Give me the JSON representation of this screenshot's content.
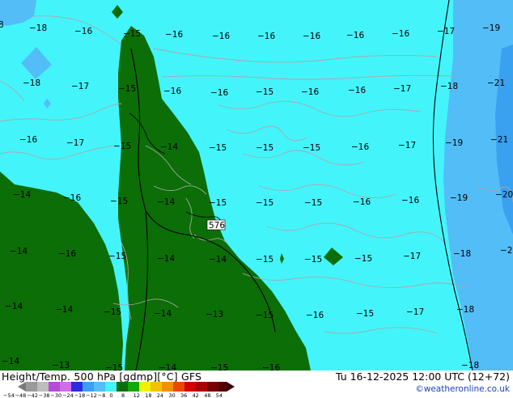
{
  "map": {
    "temperature_labels": [
      "-18",
      "-16",
      "-15",
      "-16",
      "-16",
      "-16",
      "-16",
      "-16",
      "-16",
      "-17",
      "-19",
      "-18",
      "-17",
      "-15",
      "-16",
      "-16",
      "-15",
      "-16",
      "-16",
      "-17",
      "-18",
      "-21",
      "-16",
      "-17",
      "-15",
      "-14",
      "-15",
      "-15",
      "-15",
      "-16",
      "-17",
      "-19",
      "-21",
      "-14",
      "-16",
      "-15",
      "-14",
      "-15",
      "-15",
      "-15",
      "-16",
      "-16",
      "-19",
      "-20",
      "-14",
      "-16",
      "-15",
      "-14",
      "-14",
      "-15",
      "-15",
      "-15",
      "-17",
      "-18",
      "-2",
      "-14",
      "-14",
      "-15",
      "-14",
      "-13",
      "-15",
      "-16",
      "-15",
      "-17",
      "-18",
      "-14",
      "-13",
      "-15",
      "-14",
      "-15",
      "-16",
      "-18"
    ],
    "edge_label_left": "8",
    "station_label": "576"
  },
  "footer": {
    "title": "Height/Temp. 500 hPa [gdmp][°C] GFS",
    "datetime": "Tu 16-12-2025 12:00 UTC (12+72)",
    "credit": "©weatheronline.co.uk",
    "colorbar_ticks": [
      "-54",
      "-48",
      "-42",
      "-38",
      "-30",
      "-24",
      "-18",
      "-12",
      "-8",
      "0",
      "8",
      "12",
      "18",
      "24",
      "30",
      "36",
      "42",
      "48",
      "54"
    ]
  },
  "colors": {
    "cyan": "#44f4fb",
    "green": "#0b6e06",
    "blue": "#52bdf7",
    "deep_blue": "#3aa0f0",
    "coast": "#a8a8a8"
  }
}
